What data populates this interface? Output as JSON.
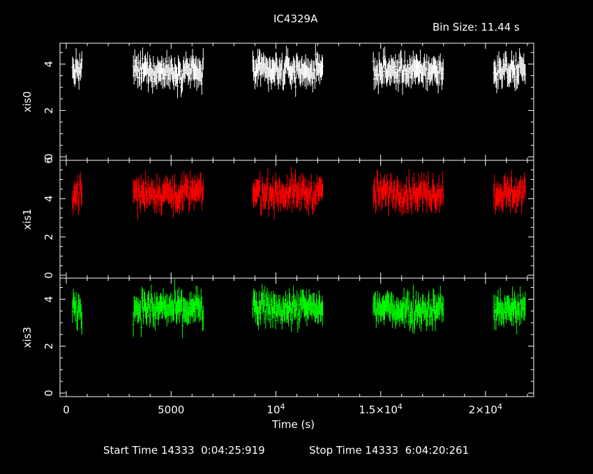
{
  "header": {
    "title": "IC4329A",
    "bin_size": "Bin Size: 11.44 s"
  },
  "footer": {
    "start_time": "Start Time 14333  0:04:25:919",
    "stop_time": "Stop Time 14333  6:04:20:261"
  },
  "colors": {
    "xis0": "#ffffff",
    "xis1": "#ff0000",
    "xis3": "#00ff00",
    "axes": "#ffffff",
    "background": "#000000"
  },
  "chart_data": {
    "type": "scatter",
    "title": "IC4329A",
    "xlabel": "Time (s)",
    "xlim": [
      -300,
      22300
    ],
    "x_ticks": [
      {
        "value": 0,
        "label": "0"
      },
      {
        "value": 5000,
        "label": "5000"
      },
      {
        "value": 10000,
        "label": "10^4"
      },
      {
        "value": 15000,
        "label": "1.5×10^4"
      },
      {
        "value": 20000,
        "label": "2×10^4"
      }
    ],
    "gti_segments": [
      [
        300,
        750
      ],
      [
        3200,
        6550
      ],
      [
        8900,
        12250
      ],
      [
        14650,
        18000
      ],
      [
        20400,
        21900
      ]
    ],
    "panels": [
      {
        "name": "xis0",
        "ylabel": "xis0",
        "ylim": [
          -0.15,
          4.9
        ],
        "yticks": [
          0,
          2,
          4
        ],
        "mean": 3.7,
        "spread": 0.35,
        "err": 0.45
      },
      {
        "name": "xis1",
        "ylabel": "xis1",
        "ylim": [
          -0.15,
          6.0
        ],
        "yticks": [
          0,
          2,
          4,
          6
        ],
        "mean": 4.3,
        "spread": 0.45,
        "err": 0.55
      },
      {
        "name": "xis3",
        "ylabel": "xis3",
        "ylim": [
          -0.15,
          4.9
        ],
        "yticks": [
          0,
          2,
          4
        ],
        "mean": 3.6,
        "spread": 0.4,
        "err": 0.45
      }
    ]
  }
}
